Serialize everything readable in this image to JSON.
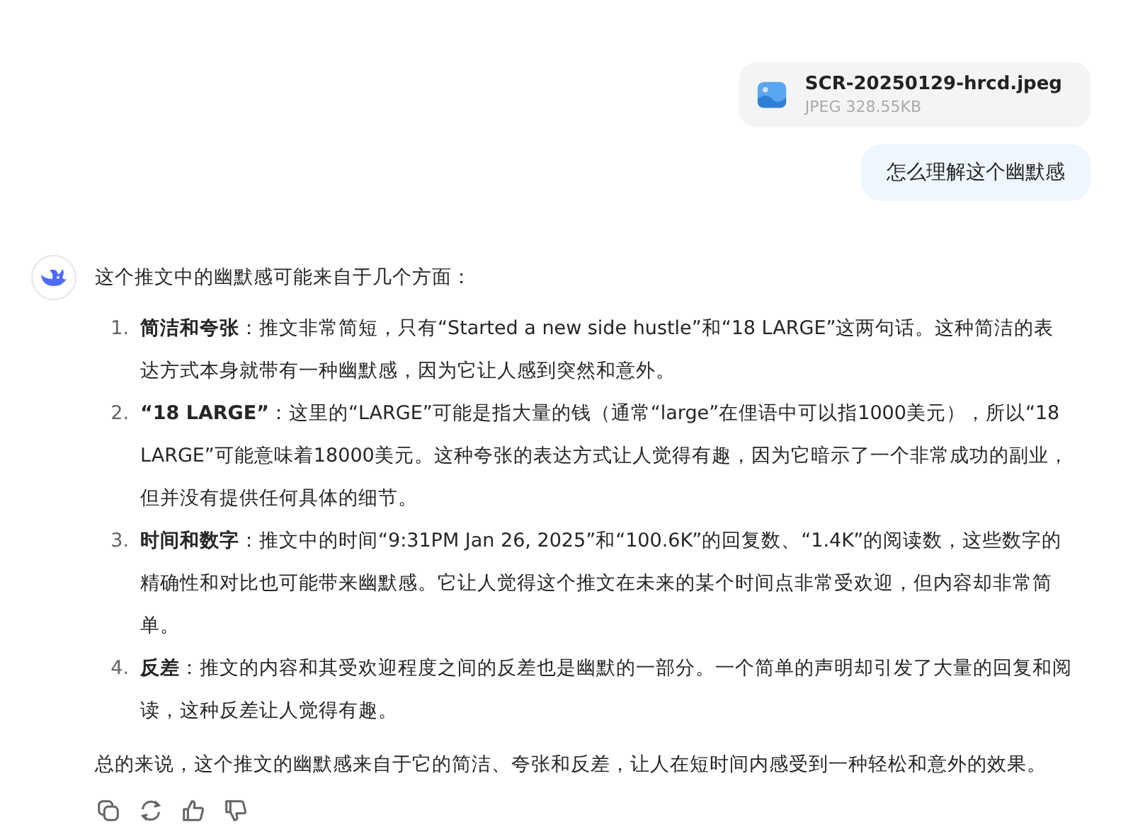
{
  "user": {
    "attachment": {
      "name": "SCR-20250129-hrcd.jpeg",
      "meta": "JPEG 328.55KB"
    },
    "message": "怎么理解这个幽默感"
  },
  "reply": {
    "intro": "这个推文中的幽默感可能来自于几个方面：",
    "points": [
      {
        "number": "1.",
        "text": "**简洁和夸张**：推文非常简短，只有“Started a new side hustle”和“18 LARGE”这两句话。这种简洁的表达方式本身就带有一种幽默感，因为它让人感到突然和意外。"
      },
      {
        "number": "2.",
        "text": "**“18 LARGE”**：这里的“LARGE”可能是指大量的钱（通常“large”在俚语中可以指1000美元），所以“18 LARGE”可能意味着18000美元。这种夸张的表达方式让人觉得有趣，因为它暗示了一个非常成功的副业，但并没有提供任何具体的细节。"
      },
      {
        "number": "3.",
        "text": "**时间和数字**：推文中的时间“9:31PM Jan 26, 2025”和“100.6K”的回复数、“1.4K”的阅读数，这些数字的精确性和对比也可能带来幽默感。它让人觉得这个推文在未来的某个时间点非常受欢迎，但内容却非常简单。"
      },
      {
        "number": "4.",
        "text": "**反差**：推文的内容和其受欢迎程度之间的反差也是幽默的一部分。一个简单的声明却引发了大量的回复和阅读，这种反差让人觉得有趣。"
      }
    ],
    "summary": "总的来说，这个推文的幽默感来自于它的简洁、夸张和反差，让人在短时间内感受到一种轻松和意外的效果。"
  }
}
